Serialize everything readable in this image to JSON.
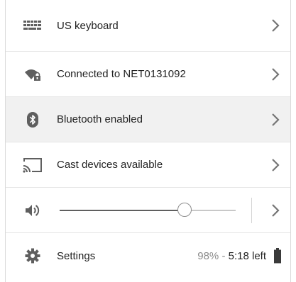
{
  "rows": {
    "keyboard": {
      "label": "US keyboard",
      "icon": "keyboard-icon"
    },
    "network": {
      "label": "Connected to NET0131092",
      "icon": "wifi-locked-icon"
    },
    "bluetooth": {
      "label": "Bluetooth enabled",
      "icon": "bluetooth-icon"
    },
    "cast": {
      "label": "Cast devices available",
      "icon": "cast-icon"
    }
  },
  "volume": {
    "icon": "speaker-icon",
    "level_percent": 71
  },
  "settings": {
    "label": "Settings",
    "icon": "gear-icon"
  },
  "battery": {
    "percent": "98%",
    "separator": " - ",
    "time_left": "5:18 left",
    "icon": "battery-icon",
    "fill_fraction": 0.98
  },
  "colors": {
    "highlight_row": "#f1f1f1",
    "icon": "#5f5f5f",
    "chevron": "#757575"
  }
}
